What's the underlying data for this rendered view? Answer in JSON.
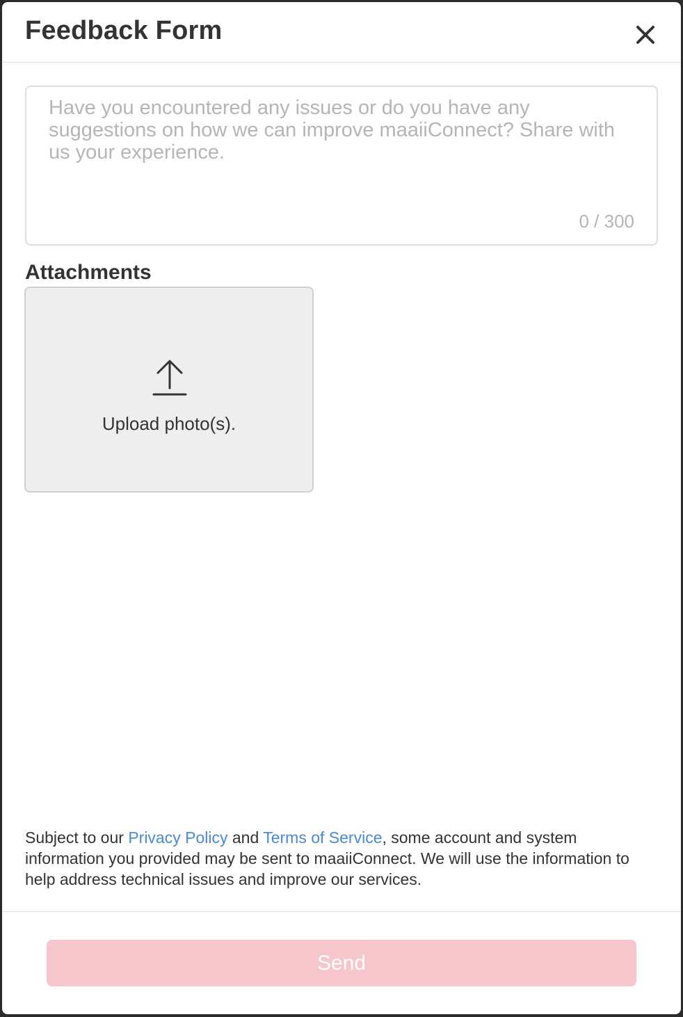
{
  "dialog": {
    "title": "Feedback Form",
    "close_icon": "close-icon"
  },
  "feedback": {
    "placeholder": "Have you encountered any issues or do you have any suggestions on how we can improve maaiiConnect? Share with us your experience.",
    "value": "",
    "counter": "0 / 300"
  },
  "attachments": {
    "label": "Attachments",
    "upload_icon": "upload-icon",
    "upload_text": "Upload photo(s)."
  },
  "disclaimer": {
    "prefix": "Subject to our ",
    "privacy_link": "Privacy Policy",
    "and": " and ",
    "terms_link": "Terms of Service",
    "suffix": ", some account and system information you provided may be sent to maaiiConnect. We will use the information to help address technical issues and improve our services."
  },
  "footer": {
    "send_label": "Send",
    "send_enabled": false
  },
  "colors": {
    "accent_disabled": "#f7c6cc",
    "link": "#4a8ad4",
    "text": "#333333",
    "placeholder": "#b5b5b5"
  }
}
